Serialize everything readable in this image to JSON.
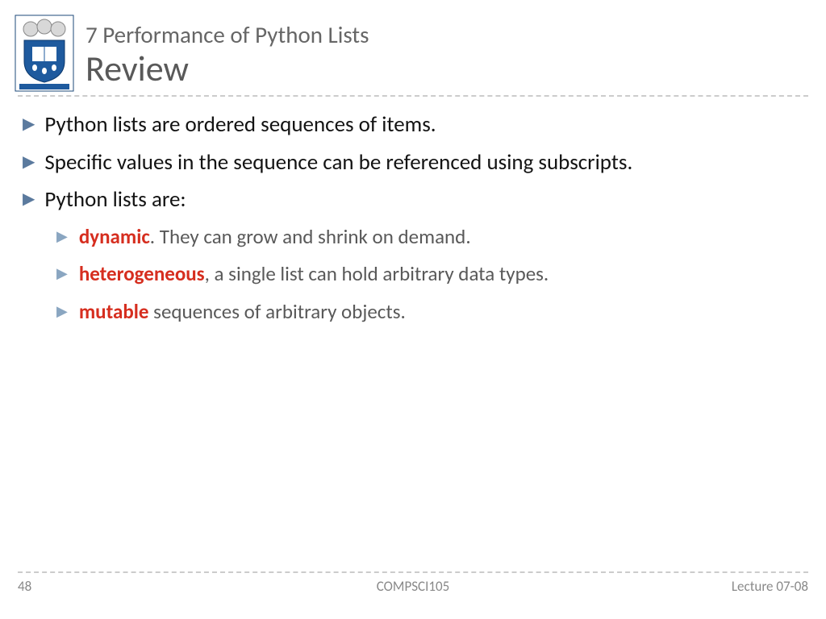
{
  "header": {
    "supertitle": "7 Performance of Python Lists",
    "title": "Review"
  },
  "bullets": [
    {
      "text": "Python lists are ordered sequences of items."
    },
    {
      "text": "Specific values in the sequence can be referenced using subscripts."
    },
    {
      "text": "Python lists are:"
    }
  ],
  "sub_bullets": [
    {
      "highlight": "dynamic",
      "rest": ". They can grow and shrink on demand."
    },
    {
      "highlight": "heterogeneous",
      "rest": ", a single list can hold arbitrary data types."
    },
    {
      "highlight": "mutable",
      "rest": " sequences of arbitrary objects."
    }
  ],
  "footer": {
    "page": "48",
    "course": "COMPSCI105",
    "lecture": "Lecture 07-08"
  }
}
